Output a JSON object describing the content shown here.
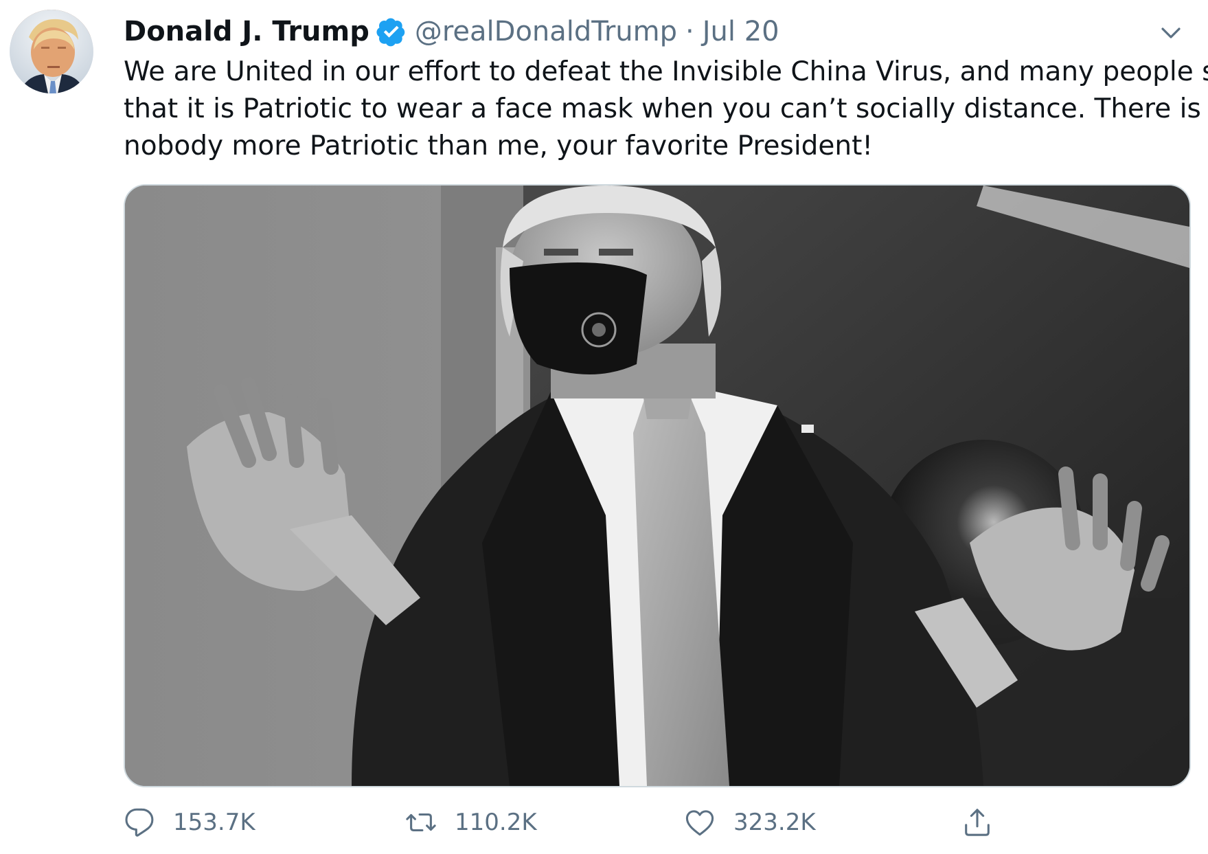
{
  "tweet": {
    "display_name": "Donald J. Trump",
    "handle": "@realDonaldTrump",
    "separator": "·",
    "date": "Jul 20",
    "text_lines": [
      "We are United in our effort to defeat the Invisible China Virus, and many people say",
      "that it is Patriotic to wear a face mask when you can’t socially distance. There is",
      "nobody more Patriotic than me, your favorite President!"
    ]
  },
  "actions": {
    "reply_count": "153.7K",
    "retweet_count": "110.2K",
    "like_count": "323.2K"
  },
  "icons": {
    "verified": "verified-badge-icon",
    "caret": "chevron-down-icon",
    "reply": "reply-icon",
    "retweet": "retweet-icon",
    "like": "heart-icon",
    "share": "share-icon"
  },
  "colors": {
    "text": "#0f1419",
    "secondary": "#5b7083",
    "verified": "#1da1f2",
    "border": "#cfd9de"
  }
}
